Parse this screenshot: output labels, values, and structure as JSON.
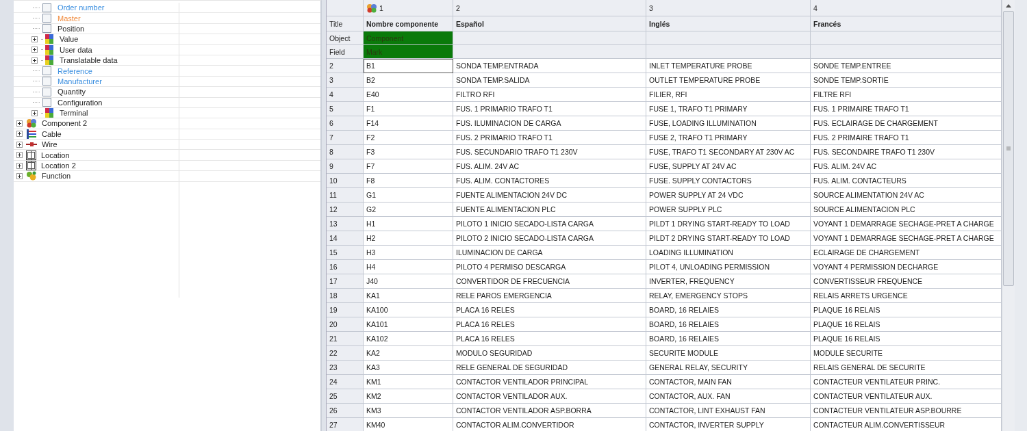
{
  "tree": {
    "nested_items": [
      {
        "kind": "field",
        "label": "Order number",
        "color": "#3b8fe0",
        "checked": false
      },
      {
        "kind": "field",
        "label": "Master",
        "color": "#f08a3c",
        "checked": false
      },
      {
        "kind": "field",
        "label": "Position",
        "color": "#222222",
        "checked": false
      },
      {
        "kind": "group",
        "label": "Value",
        "expanded": false
      },
      {
        "kind": "group",
        "label": "User data",
        "expanded": false
      },
      {
        "kind": "group",
        "label": "Translatable data",
        "expanded": false
      },
      {
        "kind": "field",
        "label": "Reference",
        "color": "#3b8fe0",
        "checked": false
      },
      {
        "kind": "field",
        "label": "Manufacturer",
        "color": "#3b8fe0",
        "checked": false
      },
      {
        "kind": "field",
        "label": "Quantity",
        "color": "#222222",
        "checked": false
      },
      {
        "kind": "field",
        "label": "Configuration",
        "color": "#222222",
        "checked": false
      },
      {
        "kind": "group",
        "label": "Terminal",
        "expanded": false
      }
    ],
    "items": [
      {
        "kind": "component",
        "label": "Component 2",
        "expanded": false
      },
      {
        "kind": "cable",
        "label": "Cable",
        "expanded": false
      },
      {
        "kind": "wire",
        "label": "Wire",
        "expanded": false
      },
      {
        "kind": "location",
        "label": "Location",
        "expanded": false
      },
      {
        "kind": "location",
        "label": "Location 2",
        "expanded": false
      },
      {
        "kind": "function",
        "label": "Function",
        "expanded": false
      }
    ]
  },
  "grid": {
    "column_numbers": [
      "1",
      "2",
      "3",
      "4"
    ],
    "meta_rows": [
      {
        "kind": "title",
        "label": "Title",
        "cells": [
          "Nombre componente",
          "Español",
          "Inglés",
          "Francés"
        ]
      },
      {
        "kind": "mapping",
        "label": "Object",
        "cells": [
          "Component",
          "",
          "",
          ""
        ]
      },
      {
        "kind": "mapping",
        "label": "Field",
        "cells": [
          "Mark",
          "",
          "",
          ""
        ]
      }
    ],
    "rows": [
      {
        "n": "2",
        "focused": true,
        "cells": [
          "B1",
          "SONDA TEMP.ENTRADA",
          "INLET TEMPERATURE PROBE",
          "SONDE TEMP.ENTREE"
        ]
      },
      {
        "n": "3",
        "focused": false,
        "cells": [
          "B2",
          "SONDA TEMP.SALIDA",
          "OUTLET TEMPERATURE PROBE",
          "SONDE TEMP.SORTIE"
        ]
      },
      {
        "n": "4",
        "focused": false,
        "cells": [
          "E40",
          "FILTRO RFI",
          "FILIER, RFI",
          "FILTRE RFI"
        ]
      },
      {
        "n": "5",
        "focused": false,
        "cells": [
          "F1",
          "FUS. 1 PRIMARIO TRAFO T1",
          "FUSE 1, TRAFO T1 PRIMARY",
          "FUS. 1 PRIMAIRE TRAFO T1"
        ]
      },
      {
        "n": "6",
        "focused": false,
        "cells": [
          "F14",
          "FUS. ILUMINACION DE CARGA",
          "FUSE, LOADING ILLUMINATION",
          "FUS. ECLAIRAGE DE CHARGEMENT"
        ]
      },
      {
        "n": "7",
        "focused": false,
        "cells": [
          "F2",
          "FUS. 2 PRIMARIO TRAFO T1",
          "FUSE 2, TRAFO T1 PRIMARY",
          "FUS. 2 PRIMAIRE TRAFO T1"
        ]
      },
      {
        "n": "8",
        "focused": false,
        "cells": [
          "F3",
          "FUS. SECUNDARIO TRAFO T1 230V",
          "FUSE, TRAFO T1 SECONDARY AT 230V AC",
          "FUS. SECONDAIRE TRAFO T1 230V"
        ]
      },
      {
        "n": "9",
        "focused": false,
        "cells": [
          "F7",
          "FUS. ALIM. 24V AC",
          "FUSE, SUPPLY AT 24V AC",
          "FUS. ALIM. 24V AC"
        ]
      },
      {
        "n": "10",
        "focused": false,
        "cells": [
          "F8",
          "FUS. ALIM. CONTACTORES",
          "FUSE. SUPPLY CONTACTORS",
          "FUS. ALIM. CONTACTEURS"
        ]
      },
      {
        "n": "11",
        "focused": false,
        "cells": [
          "G1",
          "FUENTE ALIMENTACION 24V DC",
          "POWER SUPPLY AT 24 VDC",
          "SOURCE ALIMENTATION 24V AC"
        ]
      },
      {
        "n": "12",
        "focused": false,
        "cells": [
          "G2",
          "FUENTE ALIMENTACION PLC",
          "POWER SUPPLY PLC",
          "SOURCE ALIMENTACION PLC"
        ]
      },
      {
        "n": "13",
        "focused": false,
        "cells": [
          "H1",
          "PILOTO 1 INICIO SECADO-LISTA CARGA",
          "PILDT 1 DRYING START-READY TO LOAD",
          "VOYANT 1 DEMARRAGE SECHAGE-PRET A CHARGE"
        ]
      },
      {
        "n": "14",
        "focused": false,
        "cells": [
          "H2",
          "PILOTO 2 INICIO SECADO-LISTA CARGA",
          "PILDT 2 DRYING START-READY TO LOAD",
          "VOYANT 1 DEMARRAGE SECHAGE-PRET A CHARGE"
        ]
      },
      {
        "n": "15",
        "focused": false,
        "cells": [
          "H3",
          "ILUMINACION DE CARGA",
          "LOADING ILLUMINATION",
          "ECLAIRAGE DE CHARGEMENT"
        ]
      },
      {
        "n": "16",
        "focused": false,
        "cells": [
          "H4",
          "PILOTO 4 PERMISO DESCARGA",
          "PILOT 4, UNLOADING PERMISSION",
          "VOYANT 4 PERMISSION DECHARGE"
        ]
      },
      {
        "n": "17",
        "focused": false,
        "cells": [
          "J40",
          "CONVERTIDOR DE FRECUENCIA",
          "INVERTER, FREQUENCY",
          "CONVERTISSEUR FREQUENCE"
        ]
      },
      {
        "n": "18",
        "focused": false,
        "cells": [
          "KA1",
          "RELE PAROS EMERGENCIA",
          "RELAY, EMERGENCY STOPS",
          "RELAIS ARRETS URGENCE"
        ]
      },
      {
        "n": "19",
        "focused": false,
        "cells": [
          "KA100",
          "PLACA 16 RELES",
          "BOARD, 16 RELAIES",
          "PLAQUE 16 RELAIS"
        ]
      },
      {
        "n": "20",
        "focused": false,
        "cells": [
          "KA101",
          "PLACA 16 RELES",
          "BOARD, 16 RELAIES",
          "PLAQUE 16 RELAIS"
        ]
      },
      {
        "n": "21",
        "focused": false,
        "cells": [
          "KA102",
          "PLACA 16 RELES",
          "BOARD, 16 RELAIES",
          "PLAQUE 16 RELAIS"
        ]
      },
      {
        "n": "22",
        "focused": false,
        "cells": [
          "KA2",
          "MODULO SEGURIDAD",
          "SECURITE MODULE",
          "MODULE SECURITE"
        ]
      },
      {
        "n": "23",
        "focused": false,
        "cells": [
          "KA3",
          "RELE GENERAL DE SEGURIDAD",
          "GENERAL RELAY, SECURITY",
          "RELAIS GENERAL DE SECURITE"
        ]
      },
      {
        "n": "24",
        "focused": false,
        "cells": [
          "KM1",
          "CONTACTOR VENTILADOR PRINCIPAL",
          "CONTACTOR, MAIN FAN",
          "CONTACTEUR VENTILATEUR PRINC."
        ]
      },
      {
        "n": "25",
        "focused": false,
        "cells": [
          "KM2",
          "CONTACTOR VENTILADOR AUX.",
          "CONTACTOR, AUX. FAN",
          "CONTACTEUR VENTILATEUR AUX."
        ]
      },
      {
        "n": "26",
        "focused": false,
        "cells": [
          "KM3",
          "CONTACTOR VENTILADOR ASP.BORRA",
          "CONTACTOR, LINT EXHAUST FAN",
          "CONTACTEUR VENTILATEUR ASP.BOURRE"
        ]
      },
      {
        "n": "27",
        "focused": false,
        "cells": [
          "KM40",
          "CONTACTOR ALIM.CONVERTIDOR",
          "CONTACTOR, INVERTER SUPPLY",
          "CONTACTEUR ALIM.CONVERTISSEUR"
        ]
      }
    ]
  }
}
